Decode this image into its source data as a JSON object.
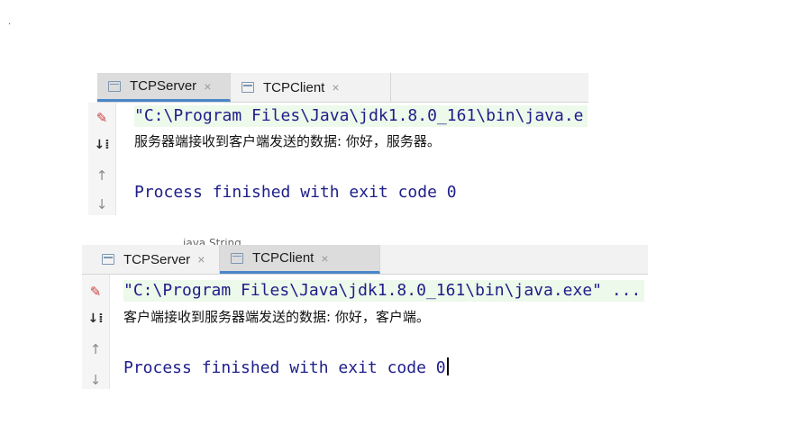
{
  "marker": ".",
  "top_console": {
    "tabs": [
      {
        "label": "TCPServer",
        "active": true
      },
      {
        "label": "TCPClient",
        "active": false
      }
    ],
    "command_line": "\"C:\\Program Files\\Java\\jdk1.8.0_161\\bin\\java.e",
    "output_line": "服务器端接收到客户端发送的数据: 你好，服务器。",
    "exit_line": "Process finished with exit code 0"
  },
  "bottom_console": {
    "tabs": [
      {
        "label": "TCPServer",
        "active": false
      },
      {
        "label": "TCPClient",
        "active": true
      }
    ],
    "command_line": "\"C:\\Program Files\\Java\\jdk1.8.0_161\\bin\\java.exe\" ...",
    "output_line": "客户端接收到服务器端发送的数据: 你好，客户端。",
    "exit_line": "Process finished with exit code 0"
  },
  "ghost_text": "java.String",
  "icons": {
    "tab": "console-tab-icon",
    "close": "close-icon",
    "clear": "clear-console-icon",
    "soft_wrap": "soft-wrap-icon",
    "up": "arrow-up-icon",
    "down": "arrow-down-icon"
  },
  "colors": {
    "accent": "#4a86c8",
    "command_bg": "#edf9ea",
    "console_text": "#1e1e8a"
  }
}
